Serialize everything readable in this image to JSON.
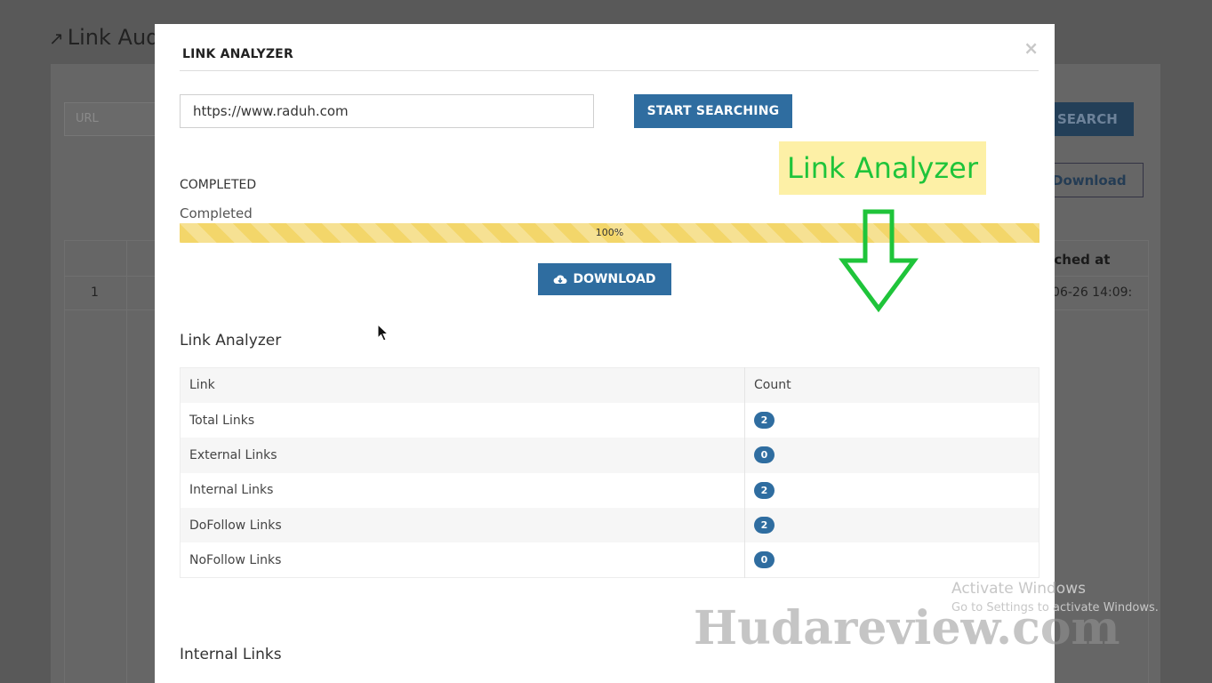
{
  "background": {
    "page_title": "Link Aud",
    "url_placeholder": "URL",
    "search_label": "SEARCH",
    "download_label": "Download",
    "column_header": "rched at",
    "row_number": "1",
    "row_date": "-06-26 14:09:"
  },
  "modal": {
    "title": "LINK ANALYZER",
    "close_symbol": "×",
    "url_value": "https://www.raduh.com",
    "start_button": "START SEARCHING",
    "status_main": "COMPLETED",
    "status_sub": "Completed",
    "progress": {
      "value": 100,
      "label": "100%",
      "color": "#f3d66a"
    },
    "download_button": "DOWNLOAD",
    "section_title": "Link Analyzer",
    "table": {
      "headers": [
        "Link",
        "Count"
      ],
      "rows": [
        {
          "label": "Total Links",
          "count": "2"
        },
        {
          "label": "External Links",
          "count": "0"
        },
        {
          "label": "Internal Links",
          "count": "2"
        },
        {
          "label": "DoFollow Links",
          "count": "2"
        },
        {
          "label": "NoFollow Links",
          "count": "0"
        }
      ]
    },
    "next_section_title": "Internal Links"
  },
  "annotation": {
    "label": "Link Analyzer",
    "text_color": "#1fc43a",
    "background_color": "#fdf0a6"
  },
  "windows_notice": {
    "line1": "Activate Windows",
    "line2": "Go to Settings to activate Windows."
  },
  "watermark": "Hudareview.com",
  "colors": {
    "primary_button": "#2f6da0",
    "badge": "#2f6da0"
  }
}
